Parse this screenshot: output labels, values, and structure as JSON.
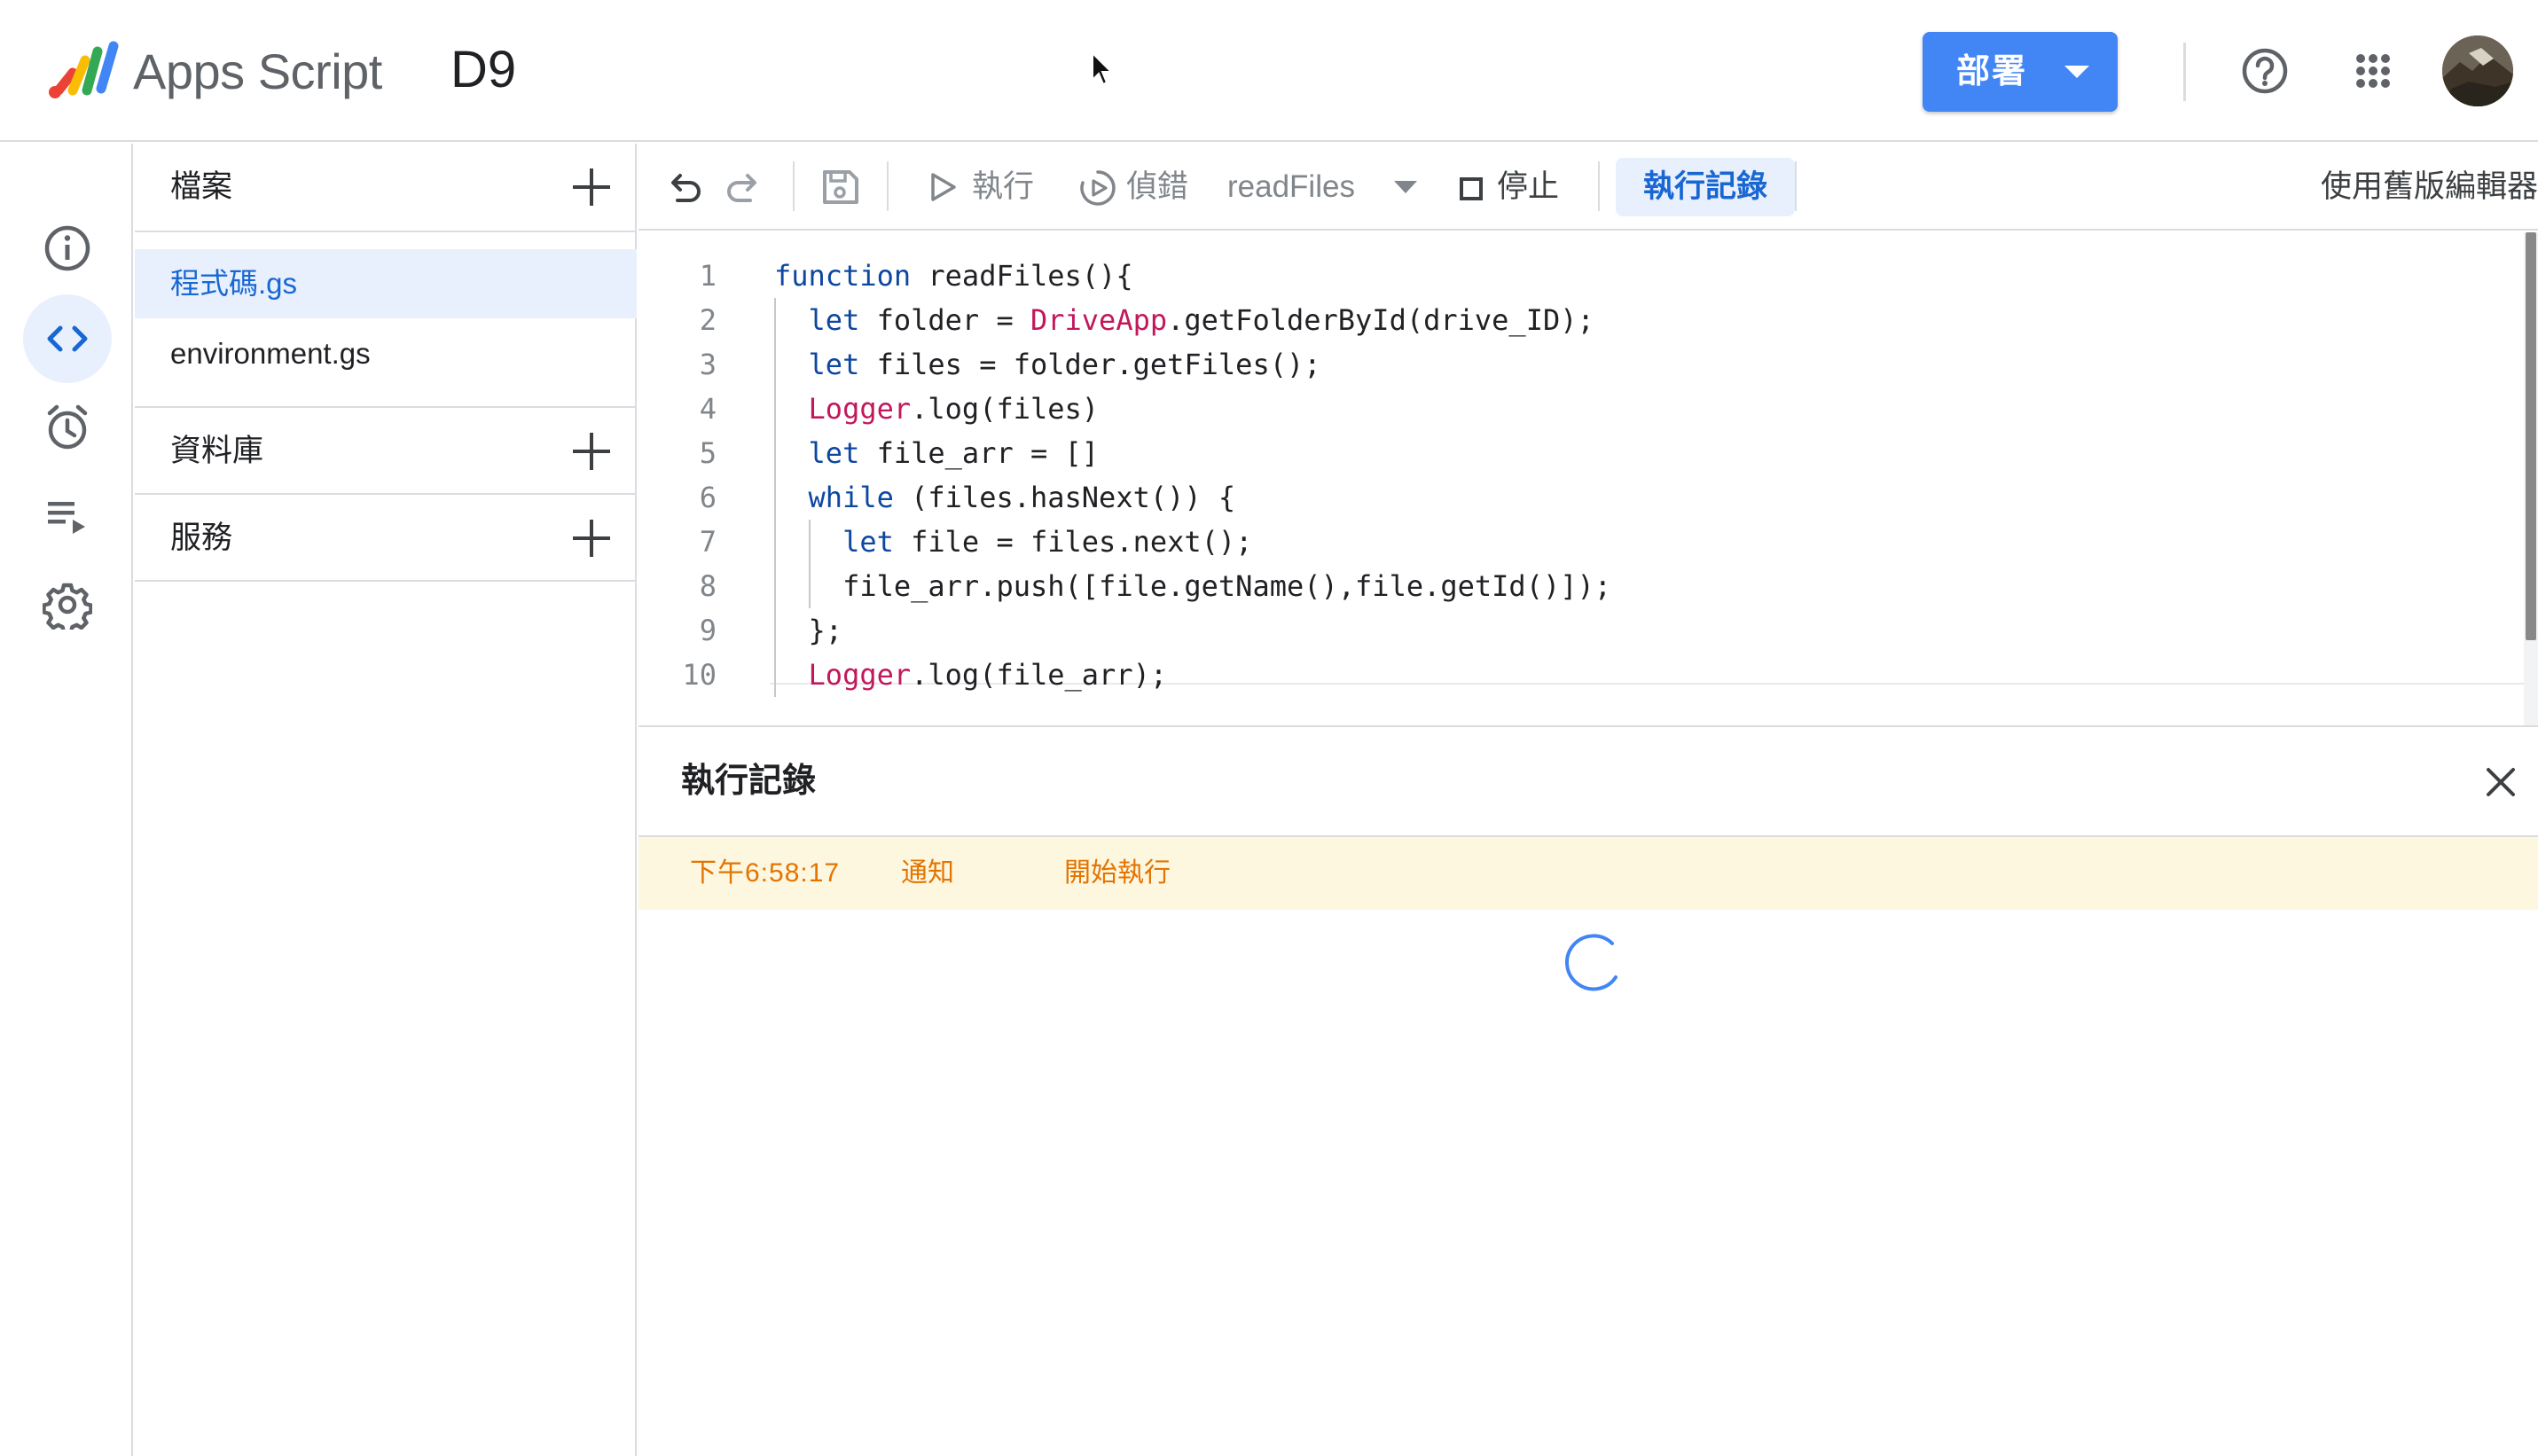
{
  "header": {
    "app_name": "Apps Script",
    "project_title": "D9",
    "deploy_label": "部署",
    "help_icon": "help-icon",
    "apps_icon": "apps-grid-icon"
  },
  "rail": {
    "items": [
      {
        "name": "overview",
        "icon": "info-icon"
      },
      {
        "name": "editor",
        "icon": "code-icon",
        "active": true
      },
      {
        "name": "triggers",
        "icon": "alarm-icon"
      },
      {
        "name": "executions",
        "icon": "executions-icon"
      },
      {
        "name": "settings",
        "icon": "gear-icon"
      }
    ]
  },
  "files_panel": {
    "files_title": "檔案",
    "files": [
      {
        "label": "程式碼.gs",
        "active": true
      },
      {
        "label": "environment.gs",
        "active": false
      }
    ],
    "libraries_title": "資料庫",
    "services_title": "服務"
  },
  "toolbar": {
    "run_label": "執行",
    "debug_label": "偵錯",
    "function_name": "readFiles",
    "stop_label": "停止",
    "execution_log_label": "執行記錄",
    "old_editor_label": "使用舊版編輯器"
  },
  "editor": {
    "lines": [
      {
        "num": "1",
        "indent": 0
      },
      {
        "num": "2",
        "indent": 1
      },
      {
        "num": "3",
        "indent": 1
      },
      {
        "num": "4",
        "indent": 1
      },
      {
        "num": "5",
        "indent": 1
      },
      {
        "num": "6",
        "indent": 1
      },
      {
        "num": "7",
        "indent": 2
      },
      {
        "num": "8",
        "indent": 2
      },
      {
        "num": "9",
        "indent": 1
      },
      {
        "num": "10",
        "indent": 1
      }
    ],
    "code": [
      "function readFiles(){",
      "  let folder = DriveApp.getFolderById(drive_ID);",
      "  let files = folder.getFiles();",
      "  Logger.log(files)",
      "  let file_arr = []",
      "  while (files.hasNext()) {",
      "    let file = files.next();",
      "    file_arr.push([file.getName(),file.getId()]);",
      "  };",
      "  Logger.log(file_arr);"
    ]
  },
  "log_panel": {
    "title": "執行記錄",
    "entries": [
      {
        "time": "下午6:58:17",
        "level": "通知",
        "message": "開始執行"
      }
    ],
    "colors": {
      "row_bg": "#fef7e0",
      "row_text": "#e37400"
    }
  },
  "colors": {
    "accent": "#4285f4",
    "active_bg": "#e8f0fe",
    "active_text": "#1967d2",
    "keyword": "#0d47a1",
    "class_name": "#c2185b"
  }
}
